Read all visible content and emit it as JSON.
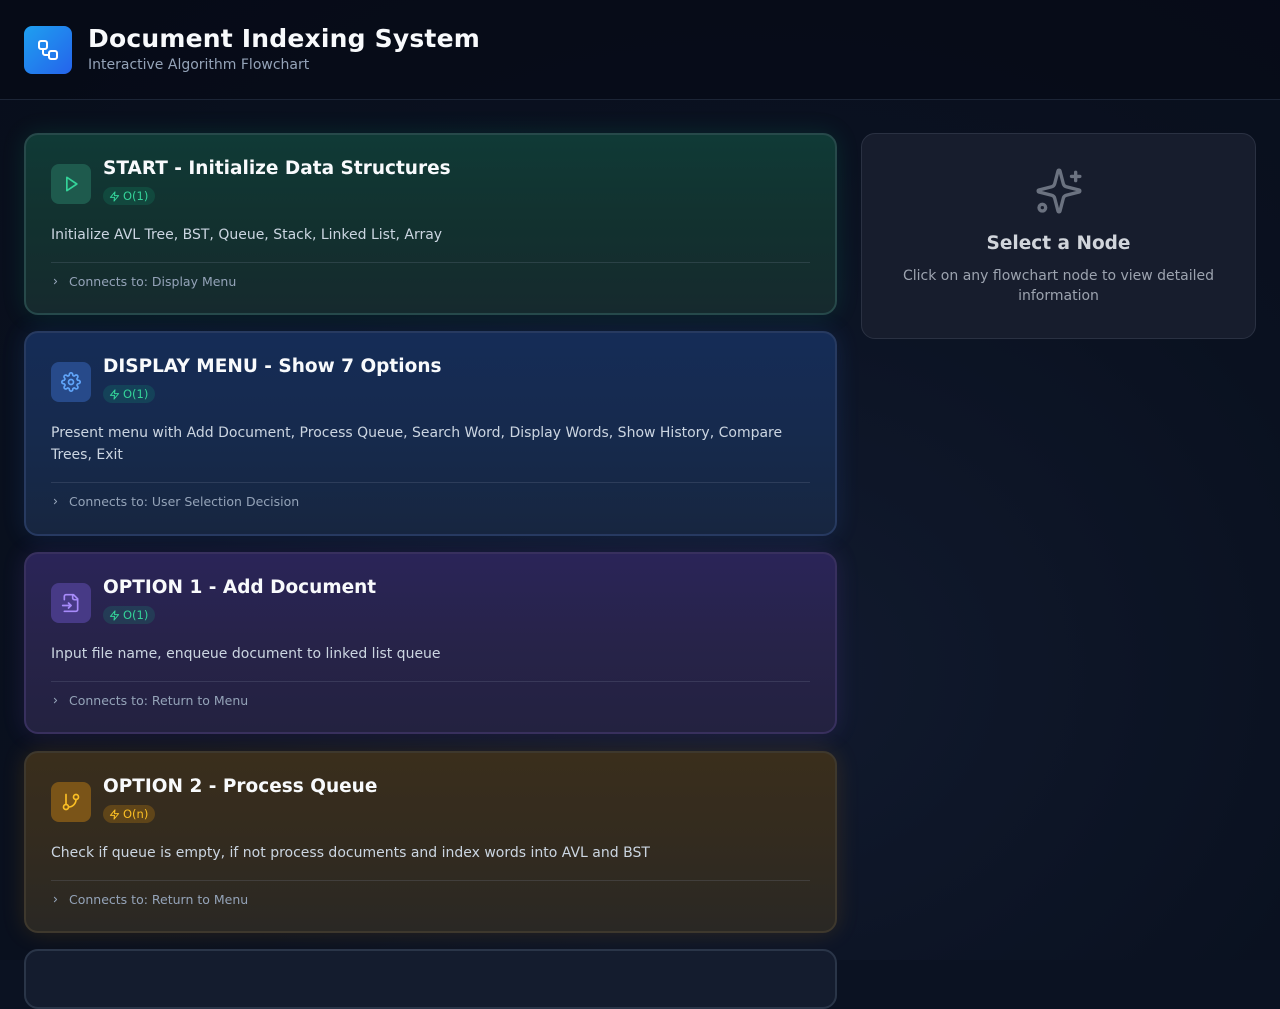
{
  "header": {
    "title": "Document Indexing System",
    "subtitle": "Interactive Algorithm Flowchart",
    "logo_icon": "workflow-icon"
  },
  "nodes": [
    {
      "title": "START - Initialize Data Structures",
      "complexity": "O(1)",
      "description": "Initialize AVL Tree, BST, Queue, Stack, Linked List, Array",
      "connects": "Connects to: Display Menu",
      "icon": "play-icon",
      "accent": "#10b981"
    },
    {
      "title": "DISPLAY MENU - Show 7 Options",
      "complexity": "O(1)",
      "description": "Present menu with Add Document, Process Queue, Search Word, Display Words, Show History, Compare Trees, Exit",
      "connects": "Connects to: User Selection Decision",
      "icon": "gear-icon",
      "accent": "#3b82f6"
    },
    {
      "title": "OPTION 1 - Add Document",
      "complexity": "O(1)",
      "description": "Input file name, enqueue document to linked list queue",
      "connects": "Connects to: Return to Menu",
      "icon": "file-input-icon",
      "accent": "#8b5cf6"
    },
    {
      "title": "OPTION 2 - Process Queue",
      "complexity": "O(n)",
      "description": "Check if queue is empty, if not process documents and index words into AVL and BST",
      "connects": "Connects to: Return to Menu",
      "icon": "git-branch-icon",
      "accent": "#f59e0b"
    }
  ],
  "detail_panel": {
    "title": "Select a Node",
    "text": "Click on any flowchart node to view detailed information",
    "icon": "sparkles-icon"
  }
}
